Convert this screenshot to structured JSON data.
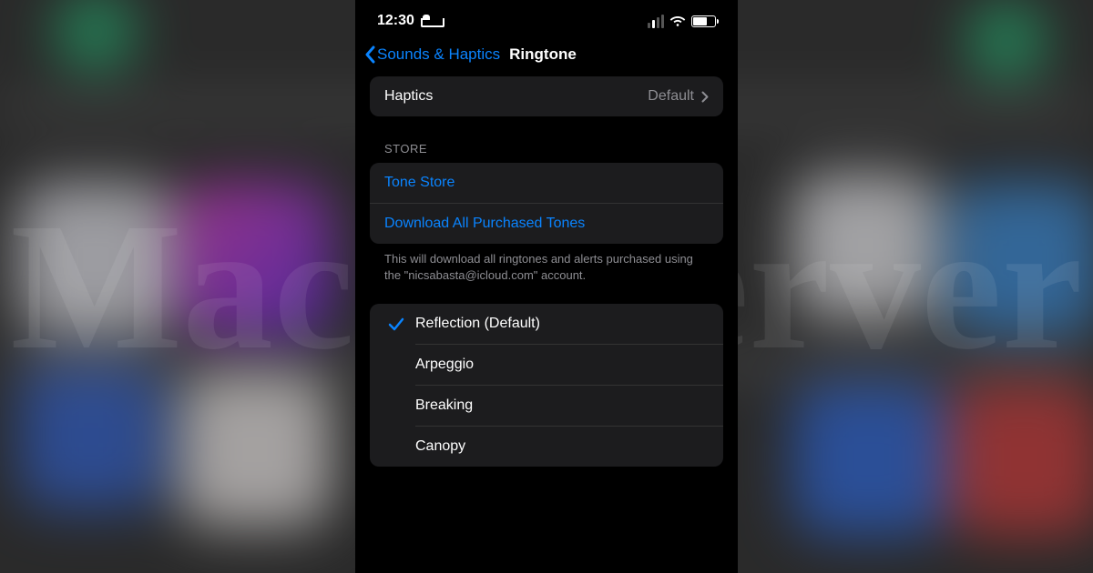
{
  "status": {
    "time": "12:30"
  },
  "nav": {
    "back_label": "Sounds & Haptics",
    "title": "Ringtone"
  },
  "haptics": {
    "label": "Haptics",
    "value": "Default"
  },
  "store": {
    "header": "STORE",
    "tone_store": "Tone Store",
    "download_all": "Download All Purchased Tones",
    "footer": "This will download all ringtones and alerts purchased using the \"nicsabasta@icloud.com\" account."
  },
  "ringtones": {
    "items": [
      {
        "label": "Reflection (Default)",
        "selected": true
      },
      {
        "label": "Arpeggio",
        "selected": false
      },
      {
        "label": "Breaking",
        "selected": false
      },
      {
        "label": "Canopy",
        "selected": false
      }
    ]
  },
  "watermark": "MacObserver"
}
